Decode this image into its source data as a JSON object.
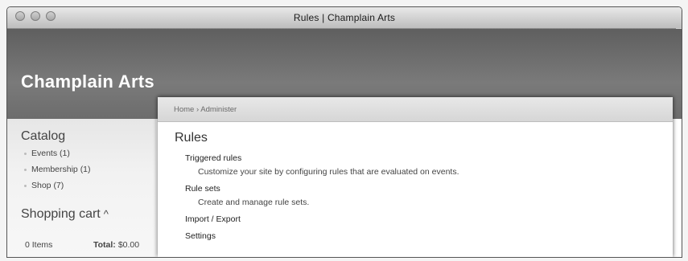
{
  "window": {
    "title": "Rules | Champlain Arts"
  },
  "site": {
    "name": "Champlain Arts"
  },
  "sidebar": {
    "catalog": {
      "title": "Catalog",
      "items": [
        {
          "label": "Events (1)"
        },
        {
          "label": "Membership (1)"
        },
        {
          "label": "Shop (7)"
        }
      ]
    },
    "cart": {
      "title": "Shopping cart",
      "caret": "^",
      "items_label": "0 Items",
      "total_label": "Total:",
      "total_value": "$0.00"
    }
  },
  "breadcrumb": {
    "home": "Home",
    "separator": "›",
    "administer": "Administer"
  },
  "main": {
    "title": "Rules",
    "entries": [
      {
        "link": "Triggered rules",
        "description": "Customize your site by configuring rules that are evaluated on events."
      },
      {
        "link": "Rule sets",
        "description": "Create and manage rule sets."
      },
      {
        "link": "Import / Export",
        "description": ""
      },
      {
        "link": "Settings",
        "description": ""
      }
    ]
  }
}
